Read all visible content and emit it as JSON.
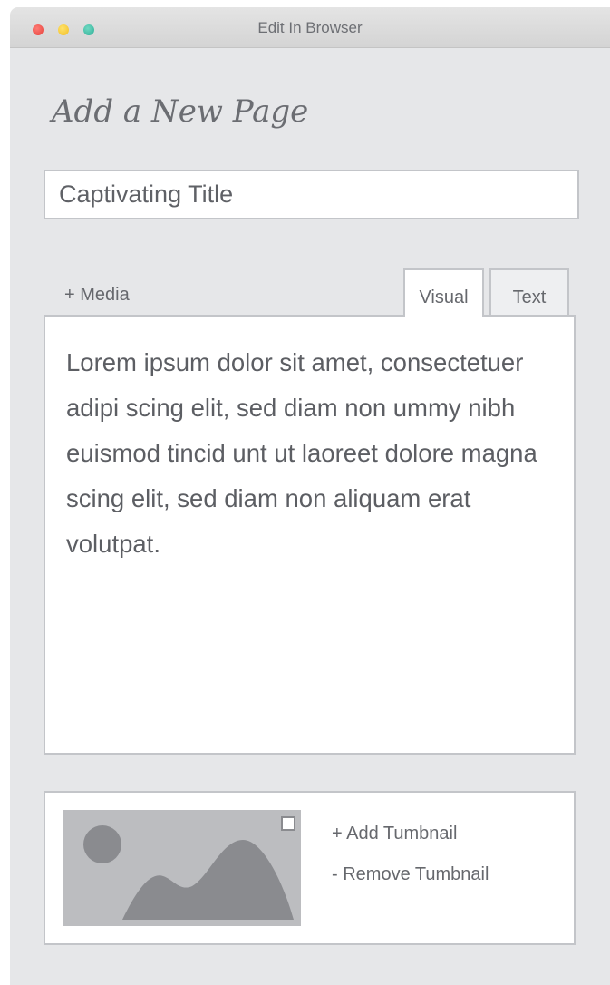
{
  "window": {
    "title": "Edit In Browser",
    "controls": [
      "close",
      "minimize",
      "zoom"
    ]
  },
  "page": {
    "heading": "Add a New Page"
  },
  "title_field": {
    "value": "Captivating Title",
    "placeholder": "Captivating Title"
  },
  "editor": {
    "media_label": "+ Media",
    "tabs": [
      {
        "label": "Visual",
        "active": true
      },
      {
        "label": "Text",
        "active": false
      }
    ],
    "body": "Lorem ipsum dolor sit amet, consectetuer adipi scing elit, sed diam non ummy nibh euismod tincid unt ut laoreet dolore magna scing elit, sed diam non aliquam erat volutpat."
  },
  "thumbnail": {
    "image_icon": "image-placeholder-icon",
    "add_label": "+ Add Tumbnail",
    "remove_label": "- Remove Tumbnail"
  },
  "colors": {
    "window_bg": "#e6e7e9",
    "panel_border": "#c3c5c9",
    "text": "#5c5e63",
    "placeholder_image": "#bcbdc0",
    "placeholder_shapes": "#8a8b8f",
    "close": "#e5413a",
    "minimize": "#f1bd25",
    "zoom": "#2fae97"
  }
}
